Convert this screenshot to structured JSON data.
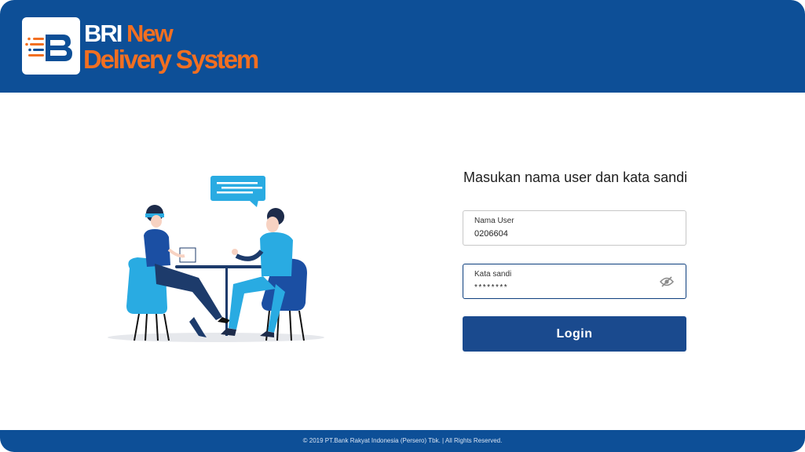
{
  "header": {
    "brand_line1_a": "BRI",
    "brand_line1_b": "New",
    "brand_line2": "Delivery System",
    "background_color": "#0d4f97",
    "accent_color": "#f26f21"
  },
  "illustration": {
    "icon": "people-meeting-illustration"
  },
  "login_form": {
    "title": "Masukan nama user dan kata sandi",
    "username_label": "Nama User",
    "username_value": "0206604",
    "password_label": "Kata sandi",
    "password_value": "********",
    "password_toggle_icon": "eye-off-icon",
    "login_label": "Login",
    "button_color": "#1a4a8e"
  },
  "footer": {
    "copyright": "© 2019 PT.Bank Rakyat Indonesia (Persero) Tbk. | All Rights Reserved."
  }
}
